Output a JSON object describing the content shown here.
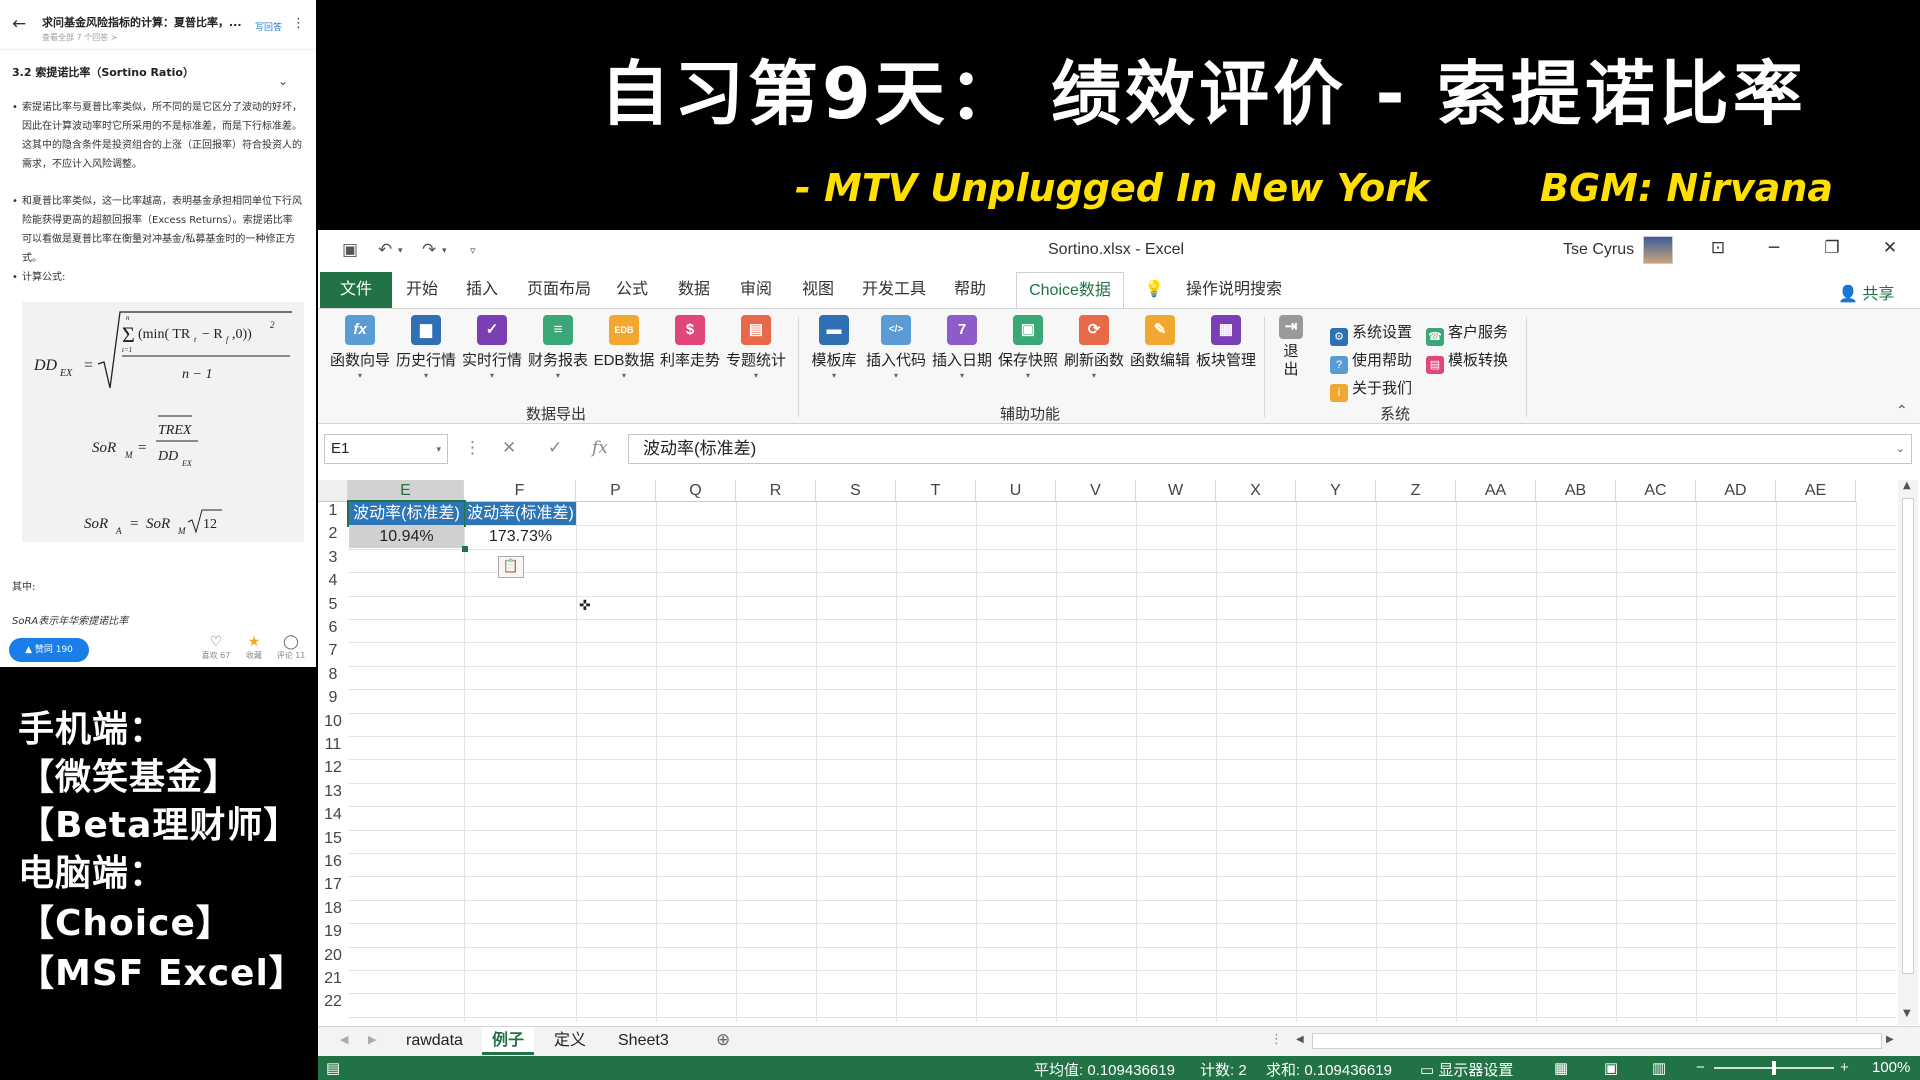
{
  "banner": {
    "title": "自习第9天： 绩效评价 - 索提诺比率",
    "subtitle": "- MTV Unplugged In New York",
    "bgm": "BGM: Nirvana"
  },
  "promo": {
    "lines": [
      "手机端：",
      "【微笑基金】",
      "【Beta理财师】",
      "电脑端：",
      "【Choice】",
      "【MSF Excel】"
    ]
  },
  "phone": {
    "question_title": "求问基金风险指标的计算：夏普比率，...",
    "view_all": "查看全部 7 个回答 >",
    "write_answer": "写回答",
    "section_title": "3.2 索提诺比率（Sortino Ratio）",
    "bullets": [
      "索提诺比率与夏普比率类似，所不同的是它区分了波动的好坏，因此在计算波动率时它所采用的不是标准差，而是下行标准差。这其中的隐含条件是投资组合的上涨（正回报率）符合投资人的需求，不应计入风险调整。",
      "和夏普比率类似，这一比率越高，表明基金承担相同单位下行风险能获得更高的超额回报率（Excess Returns）。索提诺比率可以看做是夏普比率在衡量对冲基金/私募基金时的一种修正方式。",
      "计算公式:"
    ],
    "where_label": "其中:",
    "sora_desc": "SoRA表示年华索提诺比率",
    "like_label": "▲ 赞同 190",
    "actions": [
      {
        "label": "喜欢 67",
        "icon": "heart-icon"
      },
      {
        "label": "收藏",
        "icon": "star-icon"
      },
      {
        "label": "评论 11",
        "icon": "comment-icon"
      }
    ]
  },
  "excel": {
    "doc_title": "Sortino.xlsx  -  Excel",
    "user_name": "Tse Cyrus",
    "tabs": [
      "文件",
      "开始",
      "插入",
      "页面布局",
      "公式",
      "数据",
      "审阅",
      "视图",
      "开发工具",
      "帮助",
      "Choice数据"
    ],
    "tell_me": "操作说明搜索",
    "share": "共享",
    "ribbon": {
      "group1_label": "数据导出",
      "group1": [
        "函数向导",
        "历史行情",
        "实时行情",
        "财务报表",
        "EDB数据",
        "利率走势",
        "专题统计"
      ],
      "group2_label": "辅助功能",
      "group2": [
        "模板库",
        "插入代码",
        "插入日期",
        "保存快照",
        "刷新函数",
        "函数编辑",
        "板块管理"
      ],
      "group3_label": "系统",
      "exit_label": "退出",
      "system_items": [
        "系统设置",
        "客户服务",
        "使用帮助",
        "模板转换",
        "关于我们"
      ]
    },
    "name_box": "E1",
    "formula": "波动率(标准差)",
    "columns": [
      "E",
      "F",
      "P",
      "Q",
      "R",
      "S",
      "T",
      "U",
      "V",
      "W",
      "X",
      "Y",
      "Z",
      "AA",
      "AB",
      "AC",
      "AD",
      "AE"
    ],
    "rows": [
      "1",
      "2",
      "3",
      "4",
      "5",
      "6",
      "7",
      "8",
      "9",
      "10",
      "11",
      "12",
      "13",
      "14",
      "15",
      "16",
      "17",
      "18",
      "19",
      "20",
      "21",
      "22"
    ],
    "cells": {
      "E1": "波动率(标准差)",
      "F1": "波动率(标准差)",
      "E2": "10.94%",
      "F2": "173.73%"
    },
    "sheets": [
      "rawdata",
      "例子",
      "定义",
      "Sheet3"
    ],
    "active_sheet": "例子",
    "status": {
      "average": "平均值: 0.109436619",
      "count": "计数: 2",
      "sum": "求和: 0.109436619",
      "display_settings": "显示器设置",
      "zoom": "100%"
    },
    "colors": {
      "accent": "#217346",
      "header_fill": "#2e75b6"
    }
  }
}
